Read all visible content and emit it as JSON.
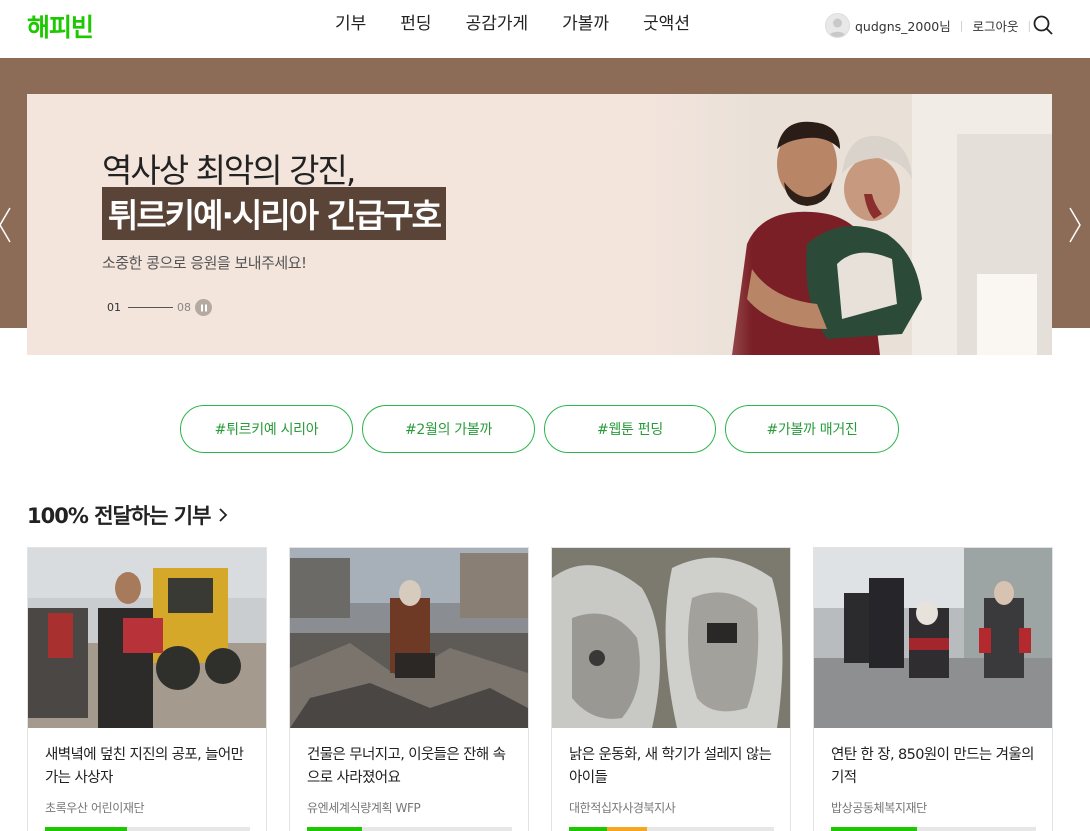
{
  "header": {
    "logo": "해피빈",
    "nav": [
      "기부",
      "펀딩",
      "공감가게",
      "가볼까",
      "굿액션"
    ],
    "username": "qudgns_2000님",
    "logout": "로그아웃"
  },
  "banner": {
    "title_line1": "역사상 최악의 강진,",
    "title_line2": "튀르키예·시리아 긴급구호",
    "subtitle": "소중한 콩으로 응원을 보내주세요!",
    "pager_current": "01",
    "pager_total": "08"
  },
  "hashtags": [
    "#튀르키예 시리아",
    "#2월의 가볼까",
    "#웹툰 펀딩",
    "#가볼까 매거진"
  ],
  "section": {
    "title": "100% 전달하는 기부"
  },
  "cards": [
    {
      "title": "새벽녘에 덮친 지진의 공포, 늘어만 가는 사상자",
      "org": "초록우산 어린이재단",
      "progress": 0.4,
      "bar_color": "#1ec800"
    },
    {
      "title": "건물은 무너지고, 이웃들은 잔해 속으로 사라졌어요",
      "org": "유엔세계식량계획 WFP",
      "progress": 0.27,
      "bar_color": "#1ec800"
    },
    {
      "title": "낡은 운동화, 새 학기가 설레지 않는 아이들",
      "org": "대한적십자사경북지사",
      "progress": 0.38,
      "bar_color": "#1ec800",
      "bar_color2": "#f5a623"
    },
    {
      "title": "연탄 한 장, 850원이 만드는 겨울의 기적",
      "org": "밥상공동체복지재단",
      "progress": 0.42,
      "bar_color": "#1ec800"
    }
  ],
  "colors": {
    "brand": "#1ec800",
    "hero_bg": "#8d6c57",
    "banner_bg": "#f3e4dc",
    "tag_border": "#2bb54c"
  }
}
